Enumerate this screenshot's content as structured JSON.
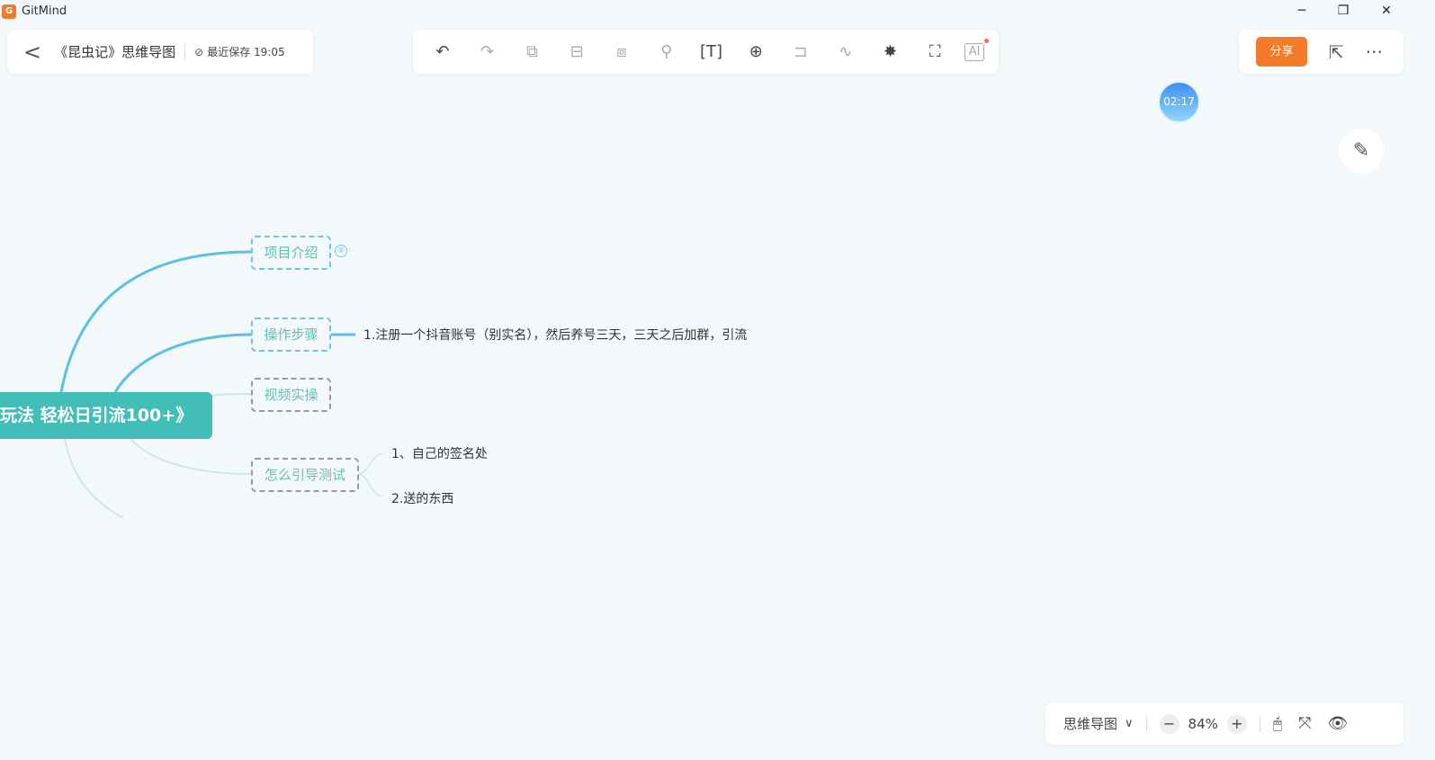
{
  "window": {
    "app_name": "GitMind",
    "minimize": "─",
    "maximize": "❐",
    "close": "✕"
  },
  "header": {
    "back": "<",
    "doc_title": "《昆虫记》思维导图",
    "save_status": "最近保存 19:05",
    "save_icon": "check-circle-icon"
  },
  "toolbar": {
    "tools": [
      "undo",
      "redo",
      "add-child-node",
      "add-sibling-node",
      "add-parent-node",
      "format-painter",
      "text",
      "insert",
      "summary",
      "relation-line",
      "style",
      "presentation",
      "ai"
    ]
  },
  "actions": {
    "share": "分享",
    "export": "⇱",
    "more": "···"
  },
  "timer": "02:17",
  "mindmap": {
    "root": "玩法  轻松日引流100+》",
    "nodes": [
      {
        "label": "项目介绍",
        "badge": "⑨"
      },
      {
        "label": "操作步骤",
        "child": "1.注册一个抖音账号（别实名），然后养号三天，三天之后加群，引流"
      },
      {
        "label": "视频实操"
      },
      {
        "label": "怎么引导测试",
        "children": [
          "1、自己的签名处",
          "2.送的东西"
        ]
      }
    ]
  },
  "bottom_bar": {
    "mode": "思维导图",
    "zoom": "84%",
    "zoom_out": "−",
    "zoom_in": "+"
  },
  "colors": {
    "accent": "#f47b2a",
    "root": "#42bdb8",
    "branch": "#5bbfe8"
  }
}
